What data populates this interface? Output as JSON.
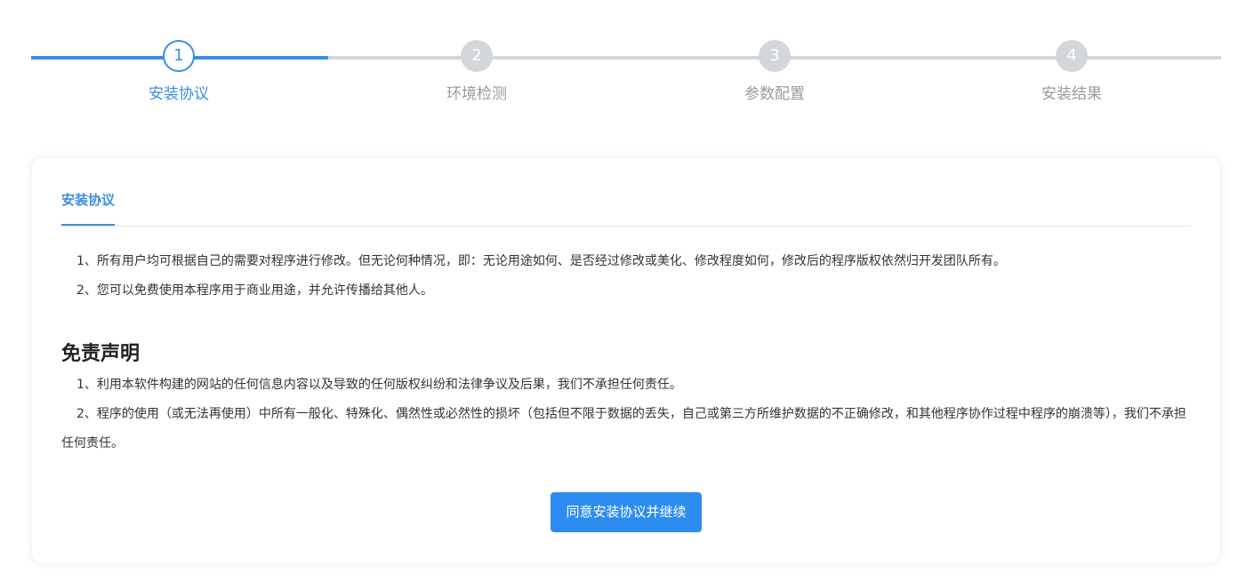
{
  "steps": [
    {
      "number": "1",
      "label": "安装协议",
      "active": true
    },
    {
      "number": "2",
      "label": "环境检测",
      "active": false
    },
    {
      "number": "3",
      "label": "参数配置",
      "active": false
    },
    {
      "number": "4",
      "label": "安装结果",
      "active": false
    }
  ],
  "colors": {
    "accent": "#3a8ee6",
    "button": "#2d8cf0",
    "inactive_step": "#d3d6db"
  },
  "card": {
    "tab_label": "安装协议",
    "agreement": [
      "1、所有用户均可根据自己的需要对程序进行修改。但无论何种情况，即：无论用途如何、是否经过修改或美化、修改程度如何，修改后的程序版权依然归开发团队所有。",
      "2、您可以免费使用本程序用于商业用途，并允许传播给其他人。"
    ],
    "disclaimer_title": "免责声明",
    "disclaimer": [
      "1、利用本软件构建的网站的任何信息内容以及导致的任何版权纠纷和法律争议及后果，我们不承担任何责任。",
      "2、程序的使用（或无法再使用）中所有一般化、特殊化、偶然性或必然性的损坏（包括但不限于数据的丢失，自己或第三方所维护数据的不正确修改，和其他程序协作过程中程序的崩溃等），我们不承担任何责任。"
    ],
    "agree_button": "同意安装协议并继续"
  }
}
